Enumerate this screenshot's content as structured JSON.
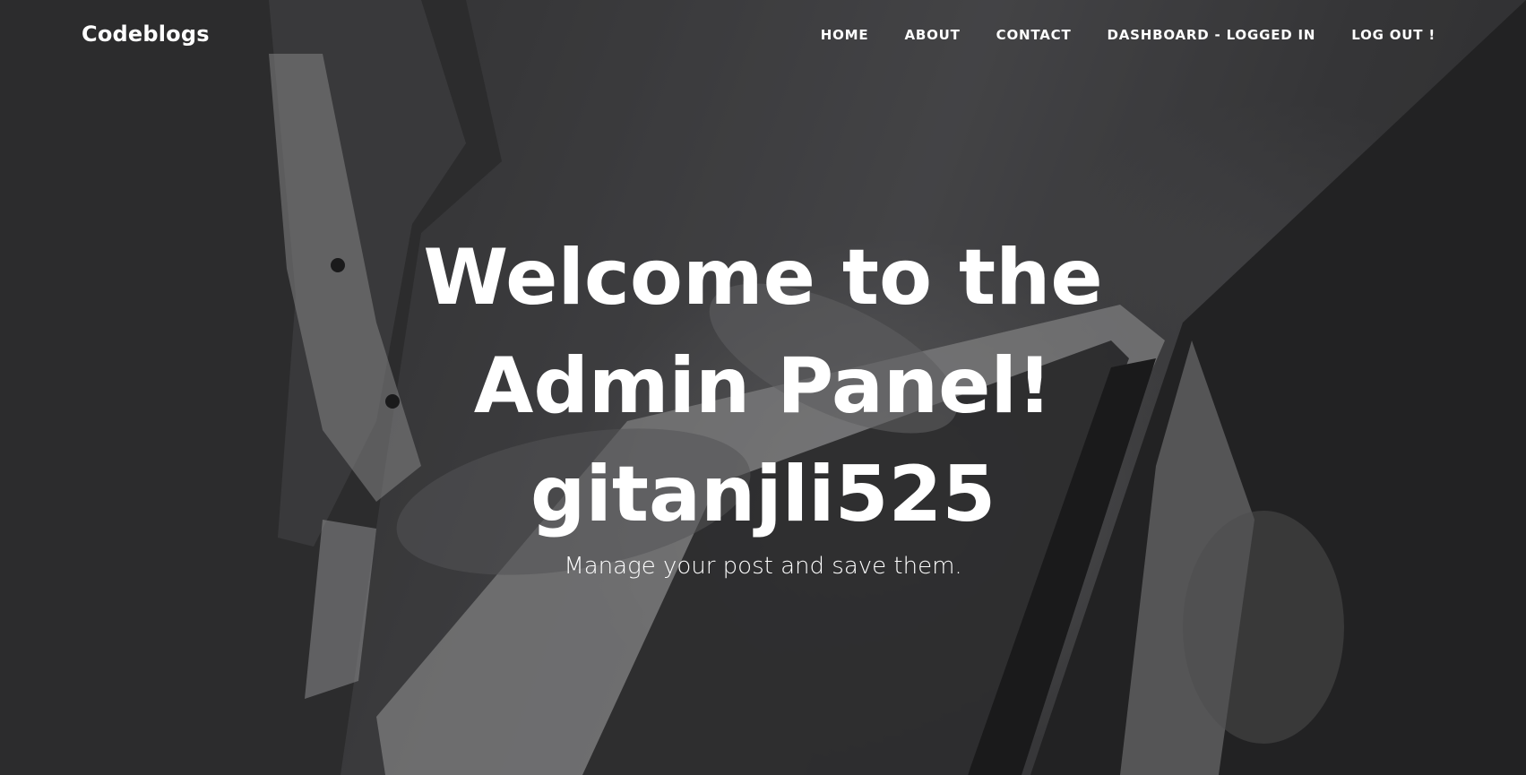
{
  "navbar": {
    "brand": "Codeblogs",
    "items": [
      {
        "label": "HOME"
      },
      {
        "label": "ABOUT"
      },
      {
        "label": "CONTACT"
      },
      {
        "label": "DASHBOARD - LOGGED IN"
      },
      {
        "label": "LOG OUT !"
      }
    ]
  },
  "hero": {
    "title_line1": "Welcome to the",
    "title_line2": "Admin Panel!",
    "title_line3": "gitanjli525",
    "subheading": "Manage your post and save them.",
    "background_image": "person-typing-on-laptop-photo"
  },
  "colors": {
    "text": "#ffffff",
    "overlay": "#141416"
  }
}
